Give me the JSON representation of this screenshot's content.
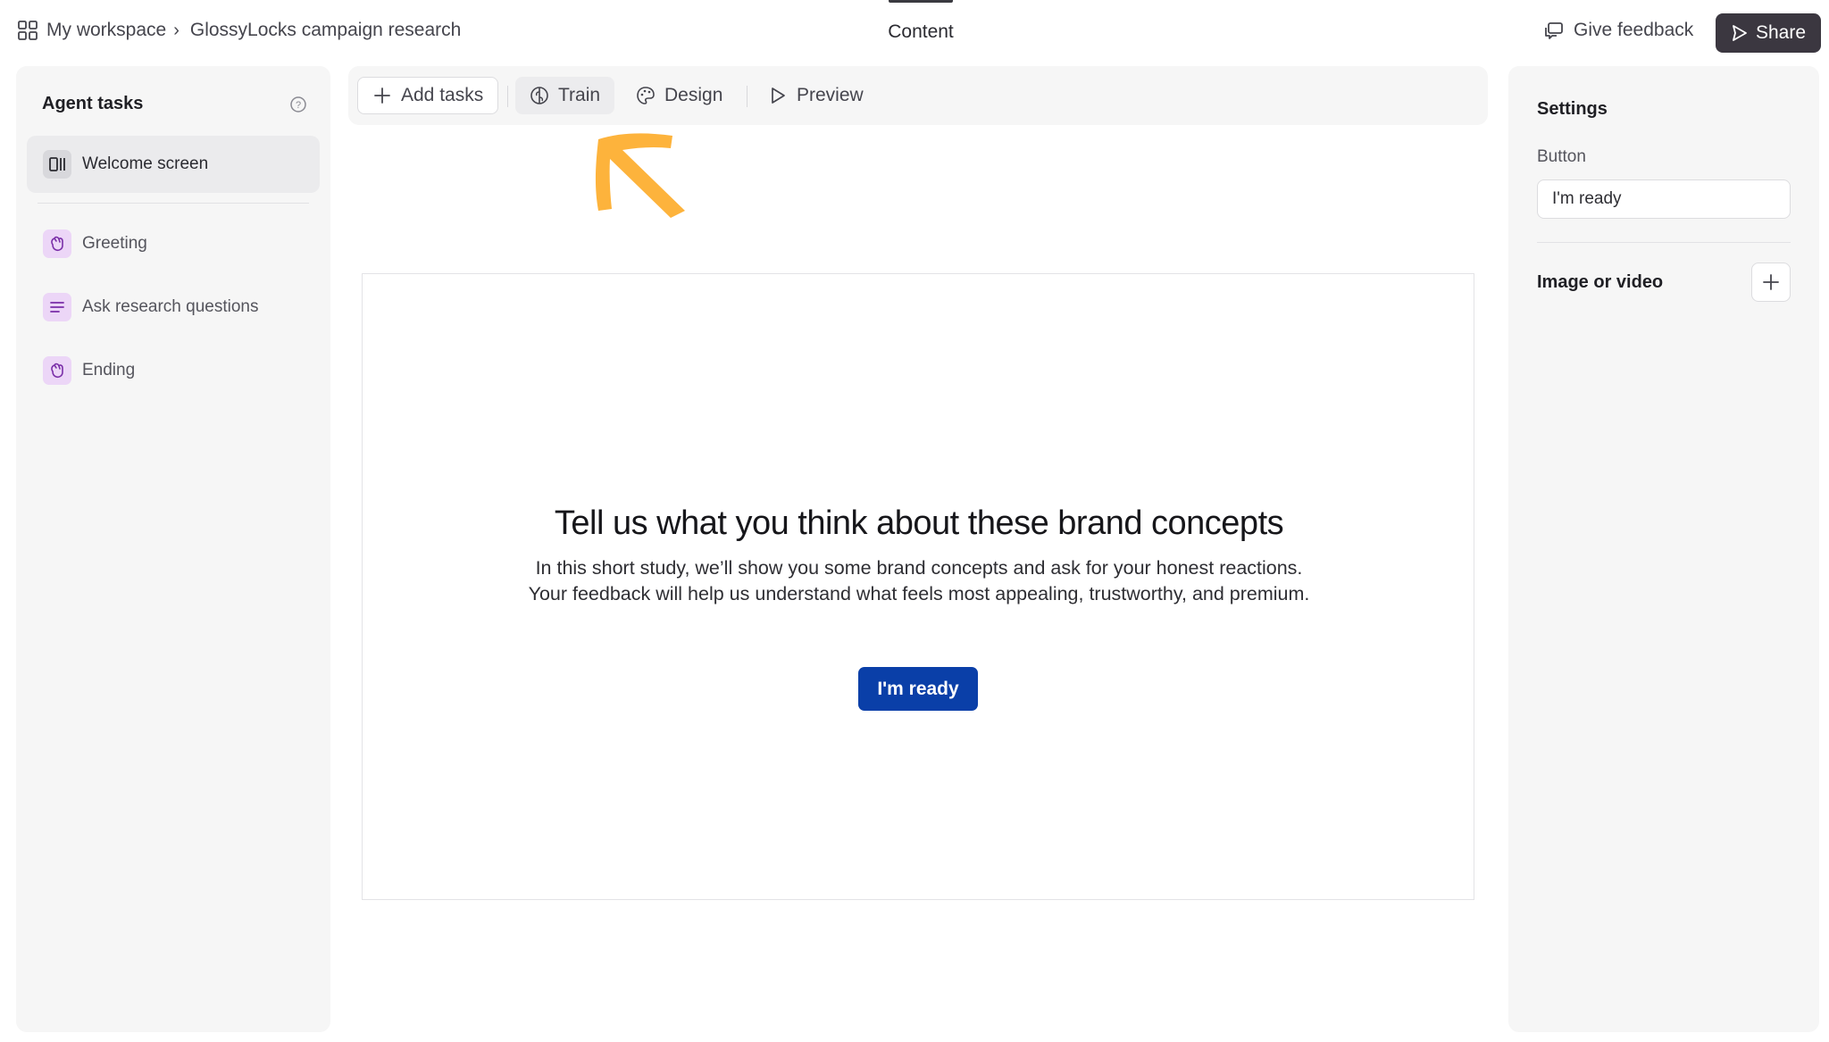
{
  "breadcrumb": {
    "workspace": "My workspace",
    "project": "GlossyLocks campaign research"
  },
  "header": {
    "center_tab": "Content",
    "feedback_label": "Give feedback",
    "share_label": "Share"
  },
  "sidebar": {
    "title": "Agent tasks",
    "items": [
      {
        "label": "Welcome screen",
        "icon": "welcome-screen-icon",
        "active": true
      },
      {
        "label": "Greeting",
        "icon": "waving-hand-icon"
      },
      {
        "label": "Ask research questions",
        "icon": "text-lines-icon"
      },
      {
        "label": "Ending",
        "icon": "waving-hand-icon"
      }
    ]
  },
  "toolbar": {
    "add_tasks": "Add tasks",
    "train": "Train",
    "design": "Design",
    "preview": "Preview"
  },
  "preview": {
    "headline": "Tell us what you think about these brand concepts",
    "body": "In this short study, we’ll show you some brand concepts and ask for your honest reactions. Your feedback will help us understand what feels most appealing, trustworthy, and premium.",
    "button_label": "I'm ready",
    "button_color": "#0a3fa8"
  },
  "settings": {
    "title": "Settings",
    "button_label_caption": "Button",
    "button_value": "I'm ready",
    "media_label": "Image or video"
  },
  "colors": {
    "accent": "#0a3fa8",
    "share_bg": "#3b3740",
    "annotation_arrow": "#fdb33c",
    "task_icon_bg": "#ecd6f7"
  }
}
